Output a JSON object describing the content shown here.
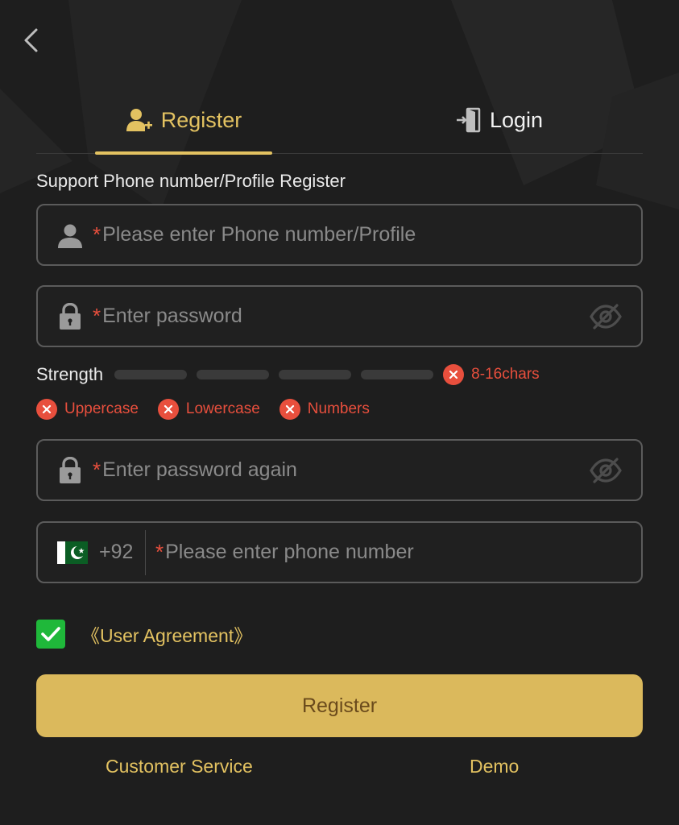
{
  "tabs": [
    {
      "label": "Register",
      "active": true,
      "icon": "user-plus-icon"
    },
    {
      "label": "Login",
      "active": false,
      "icon": "login-door-icon"
    }
  ],
  "form": {
    "subtitle": "Support Phone number/Profile Register",
    "required_mark": "*",
    "account": {
      "placeholder": "Please enter Phone number/Profile",
      "icon": "user-icon"
    },
    "password": {
      "placeholder": "Enter password",
      "icon": "lock-icon"
    },
    "password_again": {
      "placeholder": "Enter password again",
      "icon": "lock-icon"
    },
    "phone": {
      "country_code": "+92",
      "placeholder": "Please enter phone number",
      "flag": "pakistan-flag-icon"
    }
  },
  "strength": {
    "label": "Strength",
    "level": 0,
    "segments": 4,
    "rules": [
      "8-16chars",
      "Uppercase",
      "Lowercase",
      "Numbers"
    ]
  },
  "agreement": {
    "checked": true,
    "label": "《User Agreement》"
  },
  "register_button": "Register",
  "links": {
    "customer_service": "Customer Service",
    "demo": "Demo"
  },
  "colors": {
    "background": "#1e1e1e",
    "accent": "#e3c261",
    "button": "#dbb95c",
    "error": "#e84f3d",
    "checkbox": "#1fb83a"
  }
}
